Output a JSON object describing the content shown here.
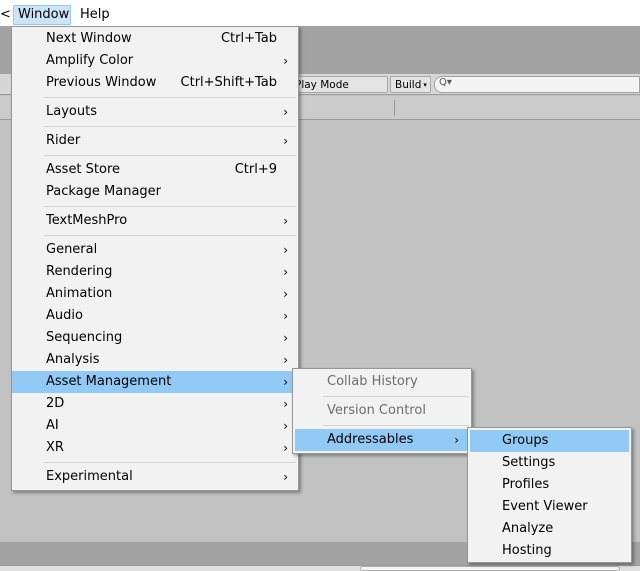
{
  "menubar": {
    "prev_fragment": "<",
    "window_label": "Window",
    "help_label": "Help"
  },
  "toolbar": {
    "playmode_label": "Play Mode Script",
    "build_label": "Build",
    "search_glyph": "Q▾",
    "caret": "▾"
  },
  "window_menu": {
    "items": [
      {
        "label": "Next Window",
        "shortcut": "Ctrl+Tab"
      },
      {
        "label": "Amplify Color",
        "arrow": "›"
      },
      {
        "label": "Previous Window",
        "shortcut": "Ctrl+Shift+Tab"
      },
      {
        "label": "Layouts",
        "arrow": "›"
      },
      {
        "label": "Rider",
        "arrow": "›"
      },
      {
        "label": "Asset Store",
        "shortcut": "Ctrl+9"
      },
      {
        "label": "Package Manager"
      },
      {
        "label": "TextMeshPro",
        "arrow": "›"
      },
      {
        "label": "General",
        "arrow": "›"
      },
      {
        "label": "Rendering",
        "arrow": "›"
      },
      {
        "label": "Animation",
        "arrow": "›"
      },
      {
        "label": "Audio",
        "arrow": "›"
      },
      {
        "label": "Sequencing",
        "arrow": "›"
      },
      {
        "label": "Analysis",
        "arrow": "›"
      },
      {
        "label": "Asset Management",
        "arrow": "›"
      },
      {
        "label": "2D",
        "arrow": "›"
      },
      {
        "label": "AI",
        "arrow": "›"
      },
      {
        "label": "XR",
        "arrow": "›"
      },
      {
        "label": "Experimental",
        "arrow": "›"
      }
    ]
  },
  "asset_management_menu": {
    "items": [
      {
        "label": "Collab History"
      },
      {
        "label": "Version Control"
      },
      {
        "label": "Addressables",
        "arrow": "›"
      }
    ]
  },
  "addressables_menu": {
    "items": [
      {
        "label": "Groups"
      },
      {
        "label": "Settings"
      },
      {
        "label": "Profiles"
      },
      {
        "label": "Event Viewer"
      },
      {
        "label": "Analyze"
      },
      {
        "label": "Hosting"
      }
    ]
  },
  "colors": {
    "highlight": "#91c9f7",
    "menu_bg": "#f2f2f2",
    "disabled_text": "#6d6d6d",
    "editor_bg": "#c2c2c2"
  }
}
